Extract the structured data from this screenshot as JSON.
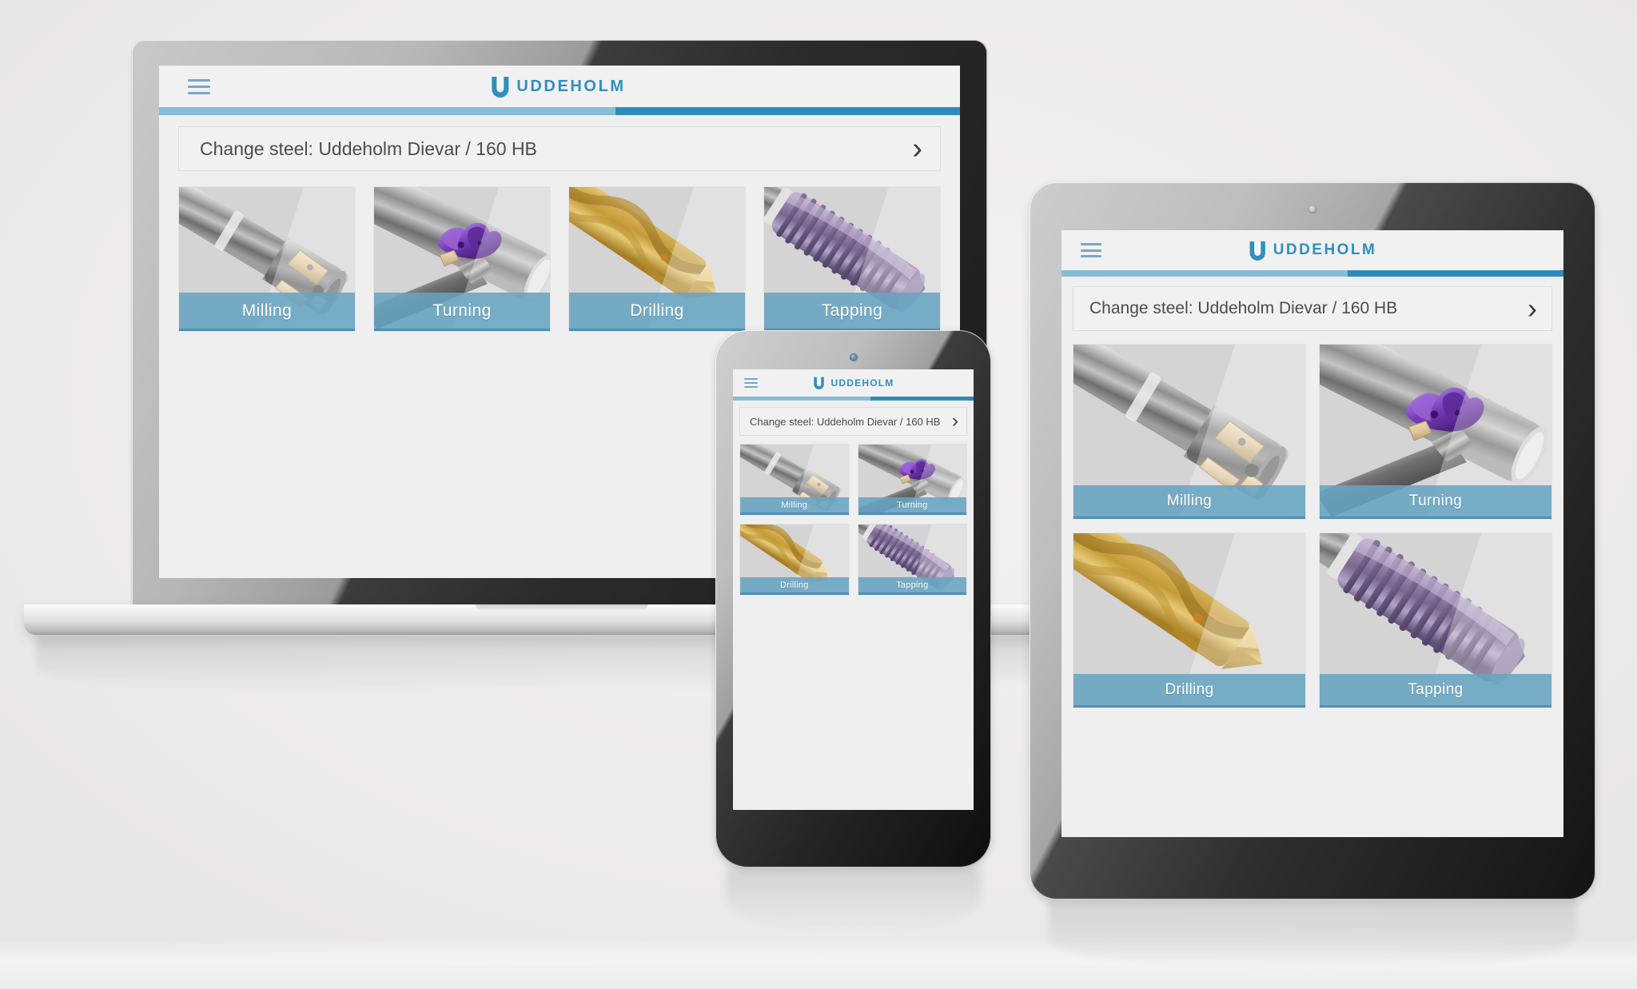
{
  "scene": {
    "background_color": "#efeeee",
    "devices": [
      "laptop",
      "tablet",
      "phone"
    ]
  },
  "brand": {
    "name": "UDDEHOLM",
    "logo_icon": "uddeholm-u-logo",
    "color": "#2f8fc0"
  },
  "app": {
    "menu_icon": "hamburger-menu-icon",
    "accent_color": "#2e8cbb",
    "steel_selector": {
      "label": "Change steel: Uddeholm Dievar / 160 HB",
      "chevron_icon": "chevron-right-icon",
      "chevron_glyph": "›"
    },
    "tools": [
      {
        "id": "milling",
        "label": "Milling",
        "art": "milling-endmill-icon",
        "accent": "#68a4c2"
      },
      {
        "id": "turning",
        "label": "Turning",
        "art": "turning-insert-icon",
        "accent": "#68a4c2"
      },
      {
        "id": "drilling",
        "label": "Drilling",
        "art": "drilling-twistdrill-icon",
        "accent": "#68a4c2"
      },
      {
        "id": "tapping",
        "label": "Tapping",
        "art": "tapping-tap-icon",
        "accent": "#68a4c2"
      }
    ]
  },
  "devices": {
    "laptop": {
      "name": "laptop",
      "camera": false
    },
    "tablet": {
      "name": "tablet",
      "camera_icon": "front-camera-icon"
    },
    "phone": {
      "name": "phone",
      "camera_icon": "front-camera-icon"
    }
  }
}
